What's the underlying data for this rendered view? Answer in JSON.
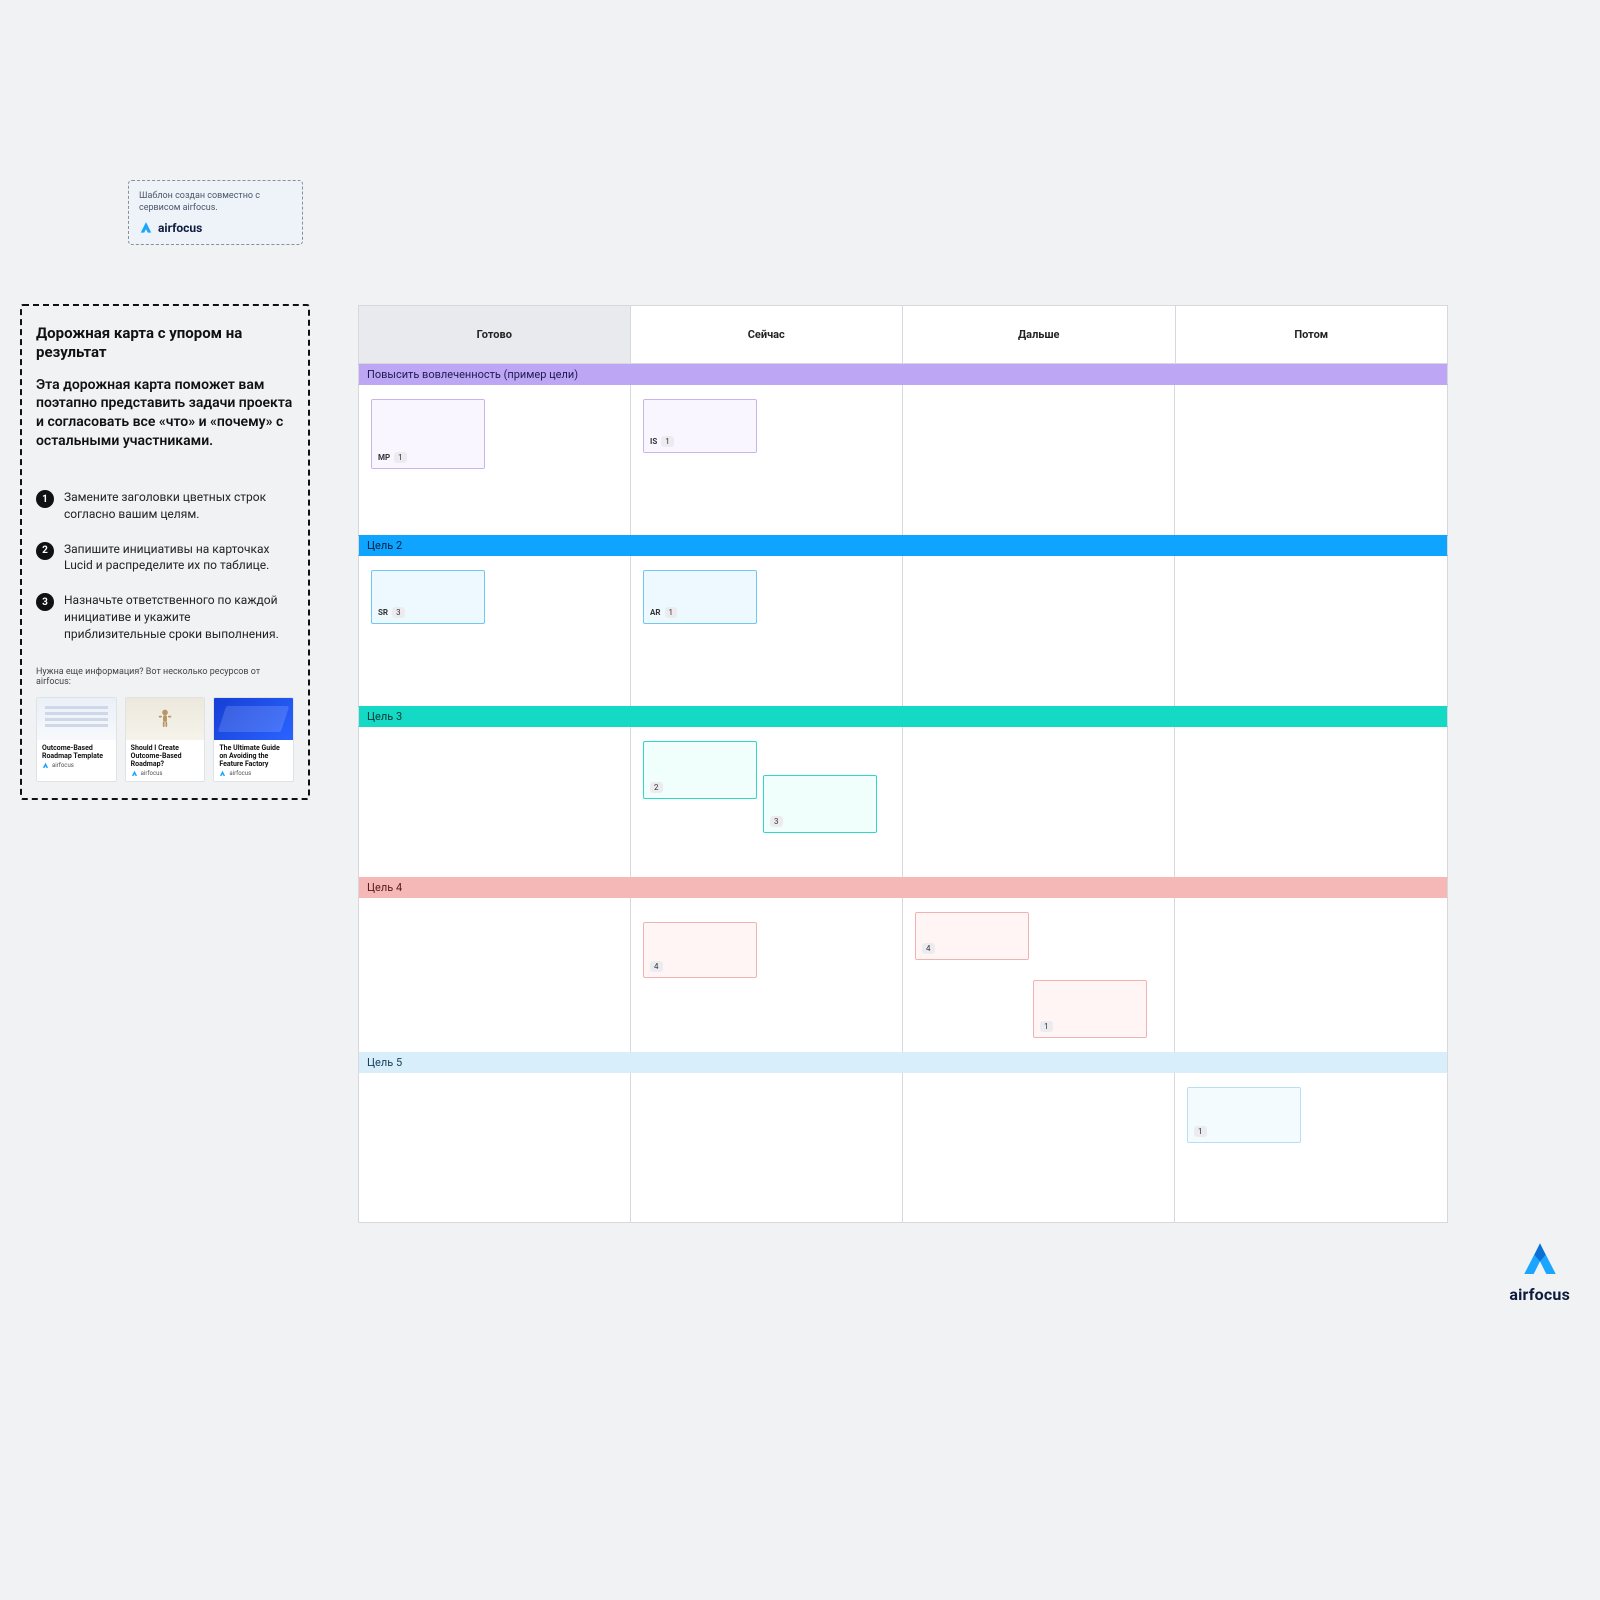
{
  "attribution": {
    "text": "Шаблон создан совместно с сервисом airfocus.",
    "brand": "airfocus"
  },
  "side_panel": {
    "title": "Дорожная карта с упором на результат",
    "description": "Эта дорожная карта поможет вам поэтапно представить задачи проекта и согласовать все «что» и «почему» с остальными участниками.",
    "steps": [
      {
        "n": "1",
        "text": "Замените заголовки цветных строк согласно вашим целям."
      },
      {
        "n": "2",
        "text": "Запишите инициативы на карточках Lucid и распределите их по таблице."
      },
      {
        "n": "3",
        "text": "Назначьте ответственного по каждой инициативе и укажите приблизительные сроки выполнения."
      }
    ],
    "more_info": "Нужна еще информация? Вот несколько ресурсов от airfocus:",
    "resources": [
      {
        "title": "Outcome-Based Roadmap Template",
        "brand": "airfocus"
      },
      {
        "title": "Should I Create Outcome-Based Roadmap?",
        "brand": "airfocus"
      },
      {
        "title": "The Ultimate Guide on Avoiding the Feature Factory",
        "brand": "airfocus"
      }
    ]
  },
  "board": {
    "columns": [
      "Готово",
      "Сейчас",
      "Дальше",
      "Потом"
    ],
    "goals": [
      {
        "label": "Повысить вовлеченность (пример цели)",
        "color": "purple",
        "cells": [
          [
            {
              "initials": "MP",
              "badge": "1"
            }
          ],
          [
            {
              "initials": "IS",
              "badge": "1"
            }
          ],
          [],
          []
        ]
      },
      {
        "label": "Цель 2",
        "color": "blue",
        "cells": [
          [
            {
              "initials": "SR",
              "badge": "3"
            }
          ],
          [
            {
              "initials": "AR",
              "badge": "1"
            }
          ],
          [],
          []
        ]
      },
      {
        "label": "Цель 3",
        "color": "teal",
        "cells": [
          [],
          [
            {
              "badge": "2"
            },
            {
              "badge": "3"
            }
          ],
          [],
          []
        ]
      },
      {
        "label": "Цель 4",
        "color": "pink",
        "cells": [
          [],
          [
            {
              "badge": "4"
            }
          ],
          [
            {
              "badge": "4"
            },
            {
              "badge": "1"
            }
          ],
          []
        ]
      },
      {
        "label": "Цель 5",
        "color": "sky",
        "cells": [
          [],
          [],
          [],
          [
            {
              "badge": "1"
            }
          ]
        ]
      }
    ]
  },
  "footer_brand": "airfocus"
}
